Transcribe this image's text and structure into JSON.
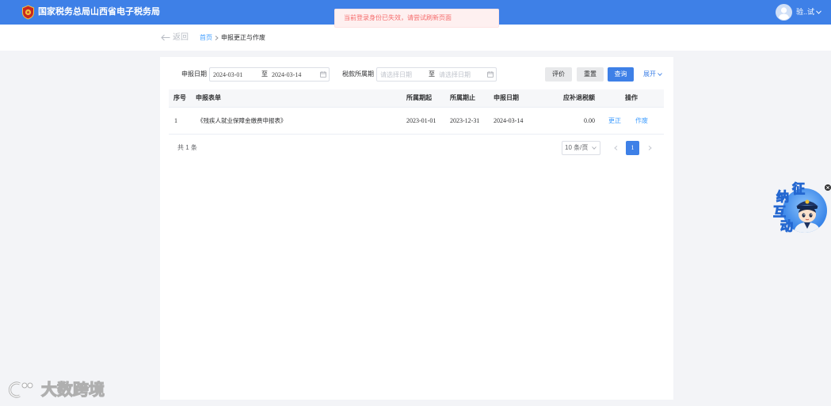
{
  "theme": {
    "primary": "#3e80e7",
    "link": "#409eff",
    "toast_text": "#f56c6c",
    "toast_bg": "#fef0f0",
    "page_bg": "#f3f4f7"
  },
  "header": {
    "logo_icon": "tax-emblem-icon",
    "title": "国家税务总局山西省电子税务局",
    "avatar_icon": "user-avatar-icon",
    "user_name": "验..试",
    "user_menu_icon": "chevron-down-icon"
  },
  "toast": {
    "message": "当前登录身份已失效，请尝试刷新页面"
  },
  "nav": {
    "back_icon": "arrow-left-icon",
    "back_label": "返回",
    "breadcrumb": {
      "home": "首页",
      "separator_icon": "chevron-right-icon",
      "current": "申报更正与作废"
    }
  },
  "filters": {
    "declare_date": {
      "label": "申报日期",
      "start": "2024-03-01",
      "separator": "至",
      "end": "2024-03-14",
      "icon": "calendar-icon"
    },
    "tax_period": {
      "label": "税款所属期",
      "start_placeholder": "请选择日期",
      "separator": "至",
      "end_placeholder": "请选择日期",
      "icon": "calendar-icon"
    },
    "buttons": {
      "evaluate": "评价",
      "reset": "重置",
      "query": "查询",
      "expand": "展开",
      "expand_icon": "chevron-down-icon"
    }
  },
  "table": {
    "columns": [
      "序号",
      "申报表单",
      "所属期起",
      "所属期止",
      "申报日期",
      "应补退税额",
      "操作"
    ],
    "rows": [
      {
        "index": "1",
        "form": "《残疾人就业保障金缴费申报表》",
        "period_start": "2023-01-01",
        "period_end": "2023-12-31",
        "declare_date": "2024-03-14",
        "amount": "0.00",
        "actions": [
          "更正",
          "作废"
        ]
      }
    ]
  },
  "pagination": {
    "total": "共 1 条",
    "page_size": "10 条/页",
    "page_size_icon": "chevron-down-icon",
    "prev_icon": "chevron-left-icon",
    "current_page": "1",
    "next_icon": "chevron-right-icon"
  },
  "widget": {
    "characters": [
      "征",
      "纳",
      "互",
      "动"
    ],
    "mascot_icon": "mascot-icon",
    "close_icon": "close-icon"
  },
  "watermark": {
    "logo_icon": "watermark-logo-icon",
    "text": "大数跨境"
  }
}
